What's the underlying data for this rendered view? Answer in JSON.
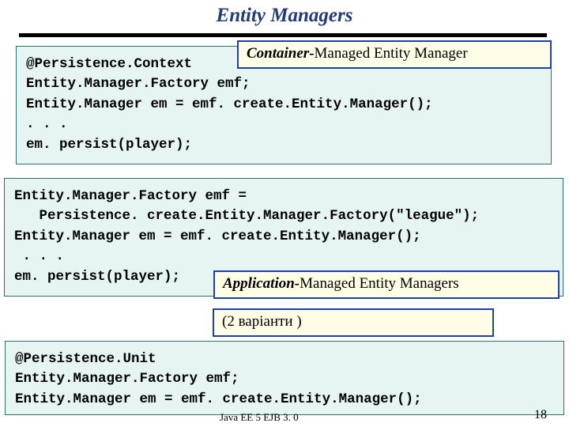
{
  "title": "Entity Managers",
  "code1": "@Persistence.Context\nEntity.Manager.Factory emf;\nEntity.Manager em = emf. create.Entity.Manager();\n. . .\nem. persist(player);",
  "label1_strong": "Container-",
  "label1_rest": "Managed Entity Manager",
  "code2": "Entity.Manager.Factory emf =\n   Persistence. create.Entity.Manager.Factory(\"league\");\nEntity.Manager em = emf. create.Entity.Manager();\n . . .\nem. persist(player);",
  "label2_strong": "Application-",
  "label2_rest": "Managed Entity Managers",
  "label3": "(2 варіанти )",
  "code3": "@Persistence.Unit\nEntity.Manager.Factory emf;\nEntity.Manager em = emf. create.Entity.Manager();",
  "footer_left": "Java EE 5 EJB 3. 0",
  "footer_right": "18"
}
